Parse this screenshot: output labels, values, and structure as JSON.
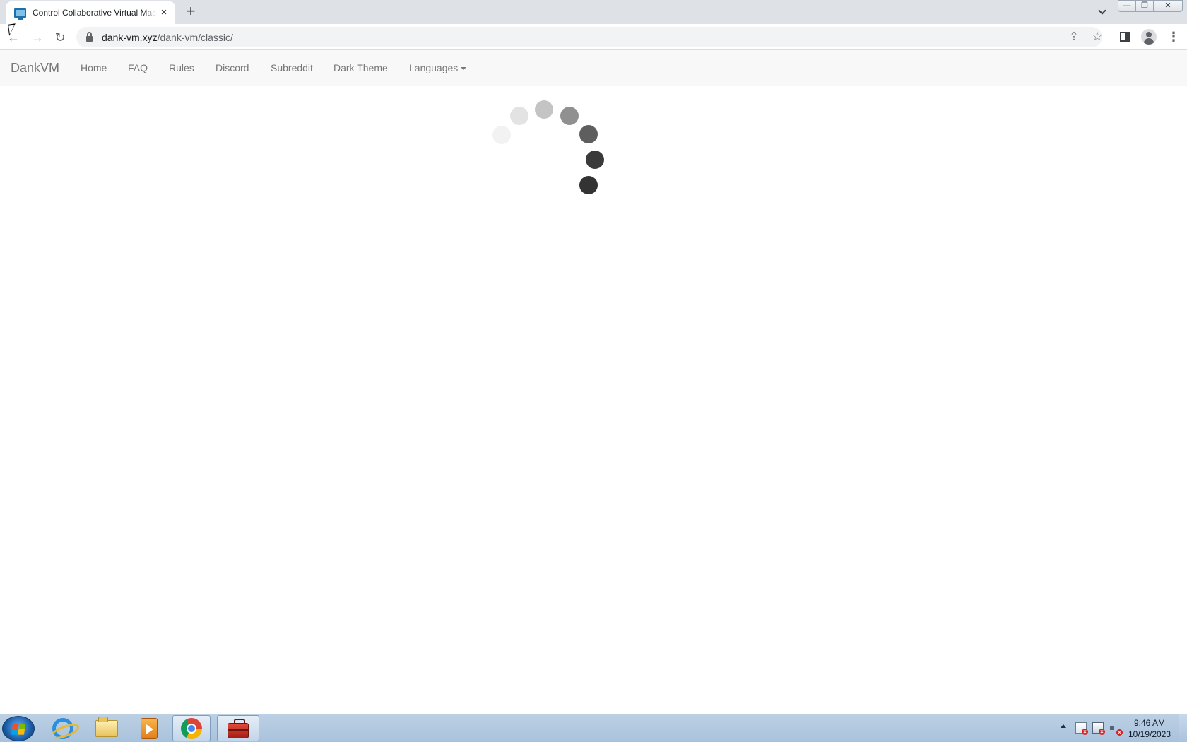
{
  "browser": {
    "tab": {
      "title": "Control Collaborative Virtual Machines",
      "icon": "monitor-icon"
    },
    "new_tab_label": "+",
    "window_controls": {
      "minimize": "—",
      "maximize": "❐",
      "close": "✕"
    },
    "toolbar": {
      "back_icon": "back-arrow-icon",
      "forward_icon": "forward-arrow-icon",
      "reload_icon": "reload-icon"
    },
    "address": {
      "domain": "dank-vm.xyz",
      "path": "/dank-vm/classic/"
    }
  },
  "site": {
    "brand": "DankVM",
    "nav": [
      {
        "label": "Home"
      },
      {
        "label": "FAQ"
      },
      {
        "label": "Rules"
      },
      {
        "label": "Discord"
      },
      {
        "label": "Subreddit"
      },
      {
        "label": "Dark Theme"
      },
      {
        "label": "Languages",
        "dropdown": true
      }
    ]
  },
  "loader": {
    "state": "loading",
    "dot_shades": [
      "#f2f2f2",
      "#e3e3e3",
      "#c4c4c4",
      "#909090",
      "#5e5e5e",
      "#3a3a3a",
      "#333333"
    ]
  },
  "taskbar": {
    "pinned": [
      {
        "name": "internet-explorer",
        "icon": "ie-icon"
      },
      {
        "name": "windows-explorer",
        "icon": "folder-icon"
      },
      {
        "name": "media-player",
        "icon": "media-player-icon"
      },
      {
        "name": "google-chrome",
        "icon": "chrome-icon",
        "active": true
      },
      {
        "name": "toolbox-app",
        "icon": "toolbox-icon"
      }
    ],
    "clock": {
      "time": "9:46 AM",
      "date": "10/19/2023"
    }
  }
}
